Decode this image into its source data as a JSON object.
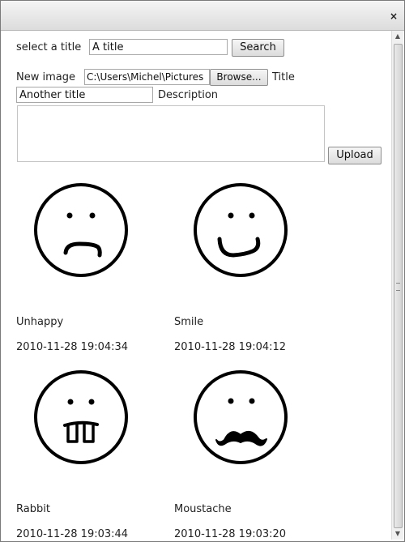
{
  "window": {
    "close_glyph": "×"
  },
  "search": {
    "label": "select a title",
    "value": "A title",
    "button": "Search"
  },
  "upload_form": {
    "file_label": "New image",
    "file_value": "C:\\Users\\Michel\\Pictures",
    "browse_button": "Browse...",
    "title_label": "Title",
    "title_value": "Another title",
    "description_label": "Description",
    "description_value": "",
    "upload_button": "Upload"
  },
  "images": [
    {
      "title": "Unhappy",
      "date": "2010-11-28 19:04:34",
      "icon": "sad-face-icon"
    },
    {
      "title": "Smile",
      "date": "2010-11-28 19:04:12",
      "icon": "smile-face-icon"
    },
    {
      "title": "Rabbit",
      "date": "2010-11-28 19:03:44",
      "icon": "rabbit-face-icon"
    },
    {
      "title": "Moustache",
      "date": "2010-11-28 19:03:20",
      "icon": "moustache-face-icon"
    }
  ]
}
